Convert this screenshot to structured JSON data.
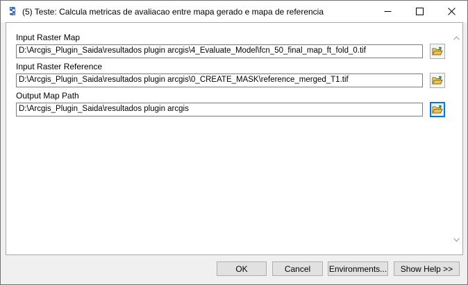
{
  "window": {
    "title": "(5) Teste: Calcula metricas de avaliacao entre mapa gerado e mapa de referencia",
    "icon": "python-script-icon",
    "controls": [
      "minimize-icon",
      "maximize-icon",
      "close-icon"
    ]
  },
  "fields": [
    {
      "label": "Input Raster Map",
      "value": "D:\\Arcgis_Plugin_Saida\\resultados plugin arcgis\\4_Evaluate_Model\\fcn_50_final_map_ft_fold_0.tif",
      "browse_icon": "open-folder-icon"
    },
    {
      "label": "Input Raster Reference",
      "value": "D:\\Arcgis_Plugin_Saida\\resultados plugin arcgis\\0_CREATE_MASK\\reference_merged_T1.tif",
      "browse_icon": "open-folder-icon"
    },
    {
      "label": "Output Map Path",
      "value": "D:\\Arcgis_Plugin_Saida\\resultados plugin arcgis",
      "browse_icon": "open-folder-icon"
    }
  ],
  "buttons": {
    "ok": "OK",
    "cancel": "Cancel",
    "environments": "Environments...",
    "show_help": "Show Help >>"
  },
  "colors": {
    "accent": "#0078d7",
    "folder": "#e8c15a"
  }
}
